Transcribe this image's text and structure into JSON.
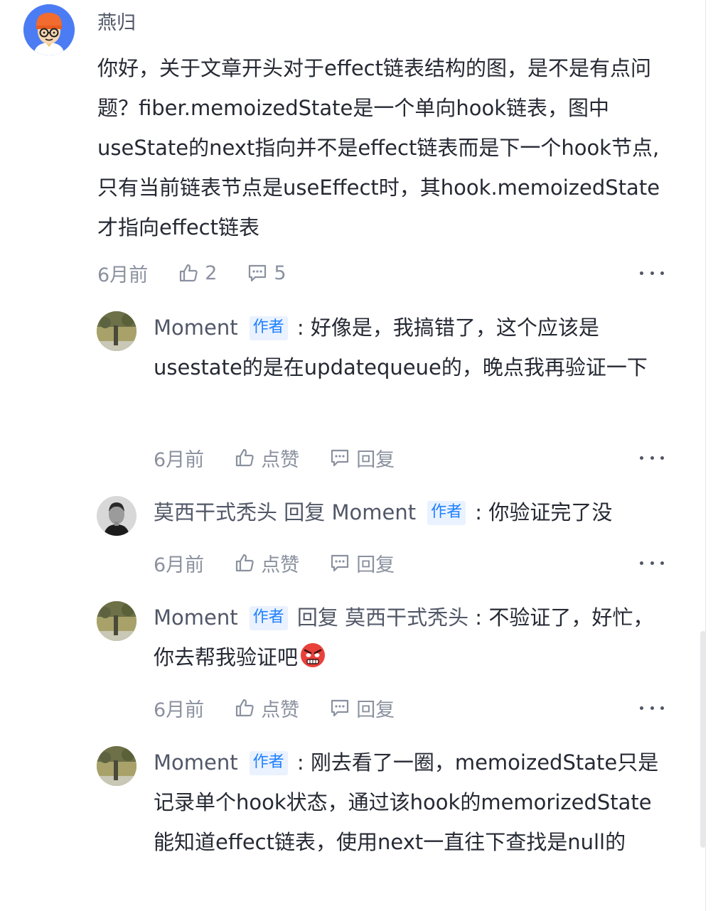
{
  "main_comment": {
    "author": "燕归",
    "content": "你好，关于文章开头对于effect链表结构的图，是不是有点问题？fiber.memoizedState是一个单向hook链表，图中useState的next指向并不是effect链表而是下一个hook节点, 只有当前链表节点是useEffect时，其hook.memoizedState才指向effect链表",
    "time": "6月前",
    "like_count": "2",
    "reply_count": "5"
  },
  "replies": [
    {
      "author": "Moment",
      "badge": "作者",
      "reply_word": "",
      "reply_to": "",
      "content": "好像是，我搞错了，这个应该是usestate的是在updatequeue的，晚点我再验证一下",
      "time": "6月前",
      "like_label": "点赞",
      "reply_label": "回复"
    },
    {
      "author": "莫西干式秃头",
      "badge": "作者",
      "reply_word": "回复",
      "reply_to": "Moment",
      "content": "你验证完了没",
      "time": "6月前",
      "like_label": "点赞",
      "reply_label": "回复"
    },
    {
      "author": "Moment",
      "badge": "作者",
      "reply_word": "回复",
      "reply_to": "莫西干式秃头",
      "content": "不验证了，好忙，你去帮我验证吧",
      "time": "6月前",
      "like_label": "点赞",
      "reply_label": "回复"
    },
    {
      "author": "Moment",
      "badge": "作者",
      "reply_word": "",
      "reply_to": "",
      "content": "刚去看了一圈，memoizedState只是记录单个hook状态，通过该hook的memorizedState能知道effect链表，使用next一直往下查找是null的"
    }
  ],
  "colors": {
    "accent": "#1e80ff",
    "badge_bg": "#eaf2ff",
    "text": "#252933",
    "muted": "#8a919f"
  }
}
